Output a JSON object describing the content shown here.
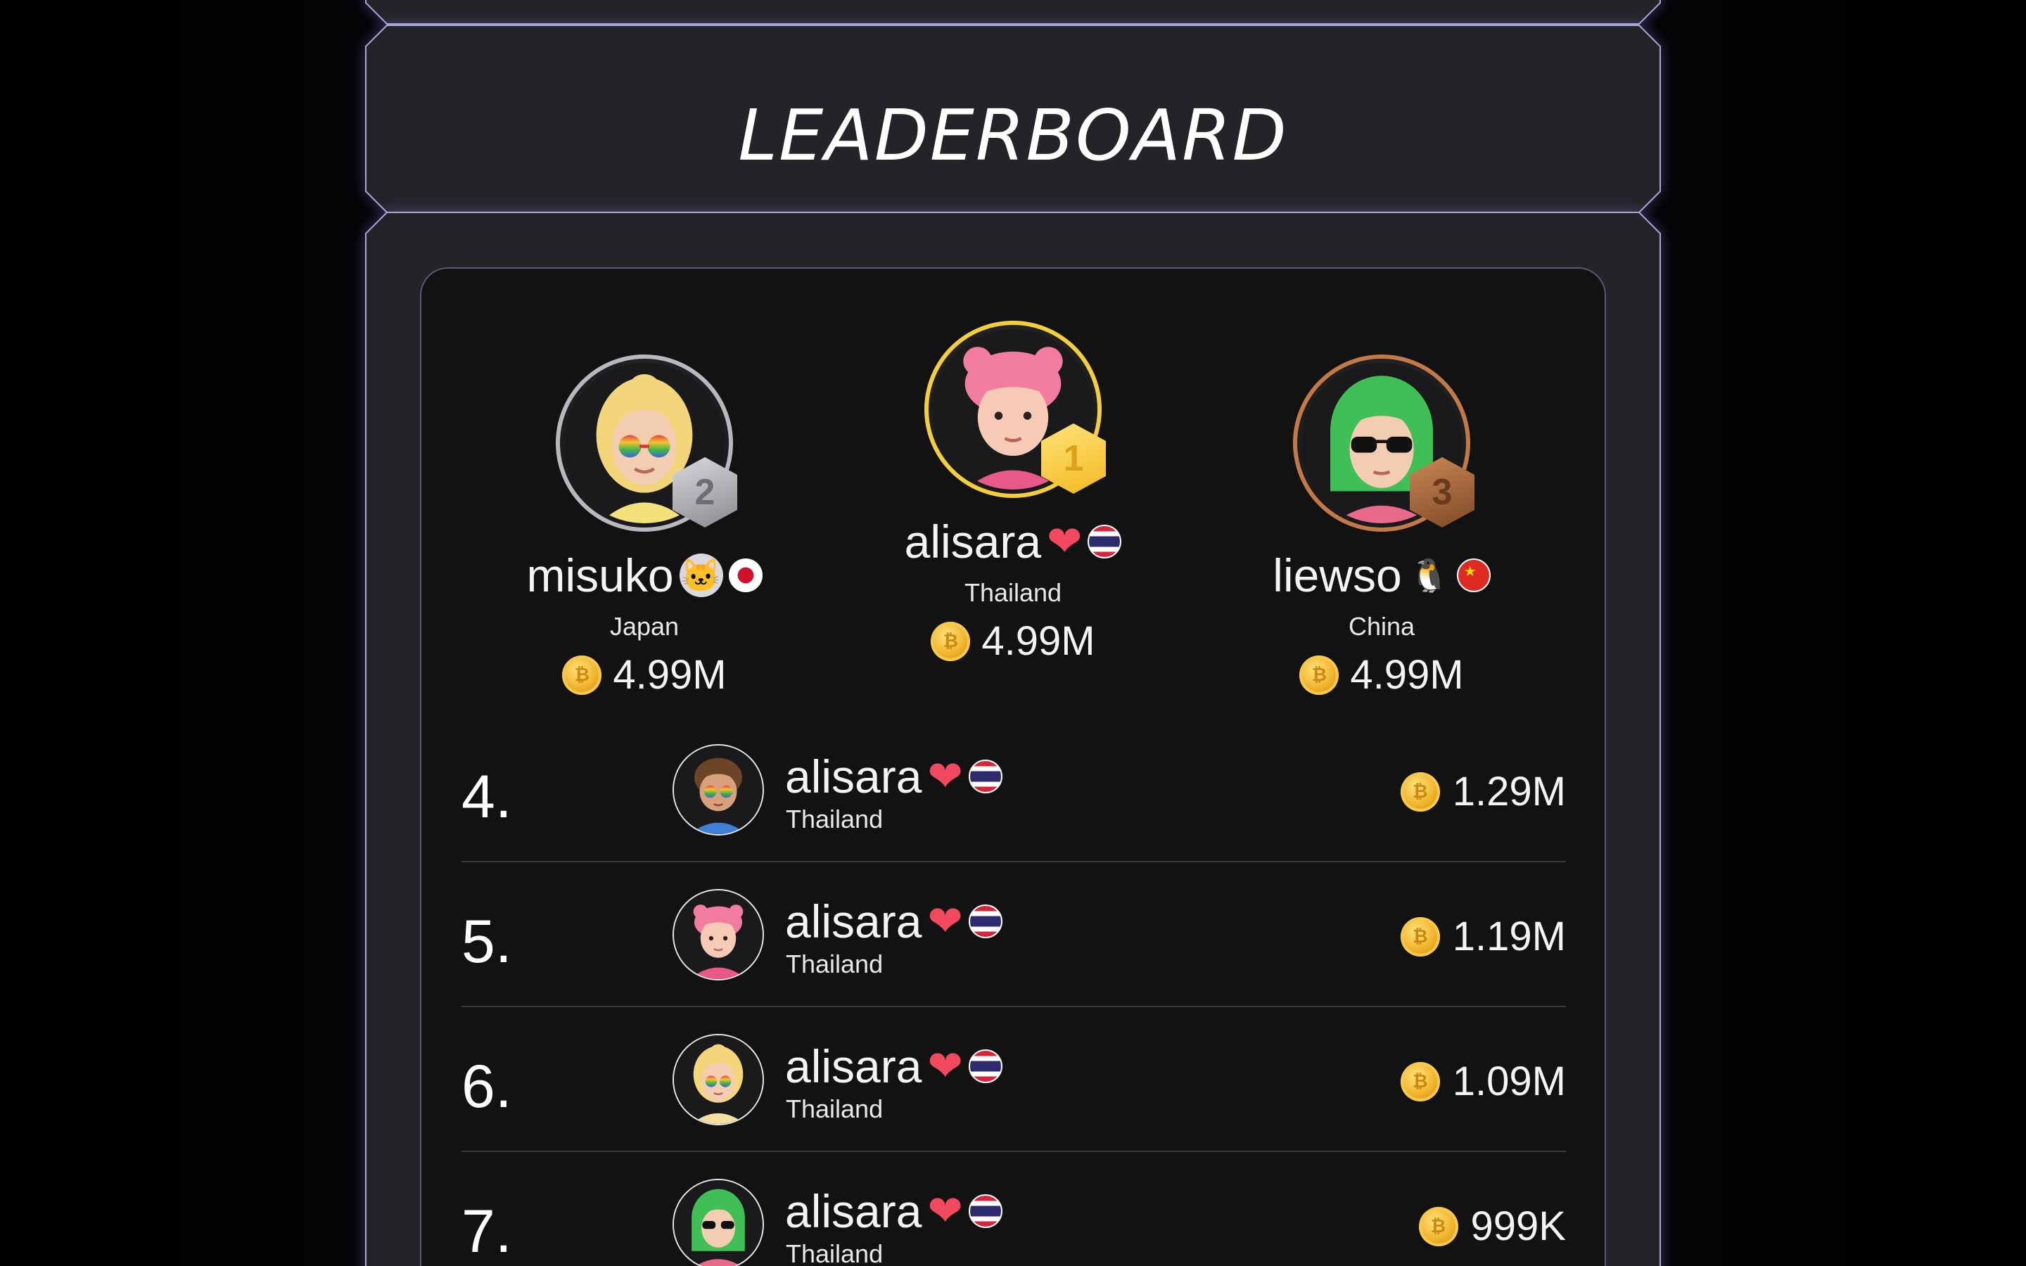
{
  "header": {
    "title": "LEADERBOARD"
  },
  "podium": [
    {
      "rank": "2",
      "name": "misuko",
      "emoji": "🐱",
      "flag": "jp",
      "country": "Japan",
      "score": "4.99M",
      "hair": "#f3d67a",
      "skin": "#f3cdb2",
      "glasses": "rainbow"
    },
    {
      "rank": "1",
      "name": "alisara",
      "emoji": "❤",
      "flag": "th",
      "country": "Thailand",
      "score": "4.99M",
      "hair": "#f37ca1",
      "skin": "#f6cab4",
      "glasses": "none"
    },
    {
      "rank": "3",
      "name": "liewso",
      "emoji": "🐧",
      "flag": "cn",
      "country": "China",
      "score": "4.99M",
      "hair": "#3fbf55",
      "skin": "#f3cdb2",
      "glasses": "dark"
    }
  ],
  "rows": [
    {
      "rank": "4.",
      "name": "alisara",
      "country": "Thailand",
      "score": "1.29M",
      "hair": "#6b4526",
      "skin": "#d9a07c",
      "glasses": "rainbow",
      "shirt": "#3f7fd6"
    },
    {
      "rank": "5.",
      "name": "alisara",
      "country": "Thailand",
      "score": "1.19M",
      "hair": "#f37ca1",
      "skin": "#f6cab4",
      "glasses": "none",
      "shirt": "#e9588a"
    },
    {
      "rank": "6.",
      "name": "alisara",
      "country": "Thailand",
      "score": "1.09M",
      "hair": "#f3d67a",
      "skin": "#f3cdb2",
      "glasses": "rainbow",
      "shirt": "#f3e0a0"
    },
    {
      "rank": "7.",
      "name": "alisara",
      "country": "Thailand",
      "score": "999K",
      "hair": "#3fbf55",
      "skin": "#f3cdb2",
      "glasses": "dark",
      "shirt": "#e96a8a"
    }
  ],
  "icons": {
    "coin": "coin-icon",
    "heart": "heart-icon",
    "flag": "thailand-flag-icon"
  },
  "colors": {
    "gold": "#f5cf3a",
    "silver": "#b9b9bd",
    "bronze": "#c37a46",
    "heart": "#f14a5e",
    "frame": "#a9a6d8"
  }
}
